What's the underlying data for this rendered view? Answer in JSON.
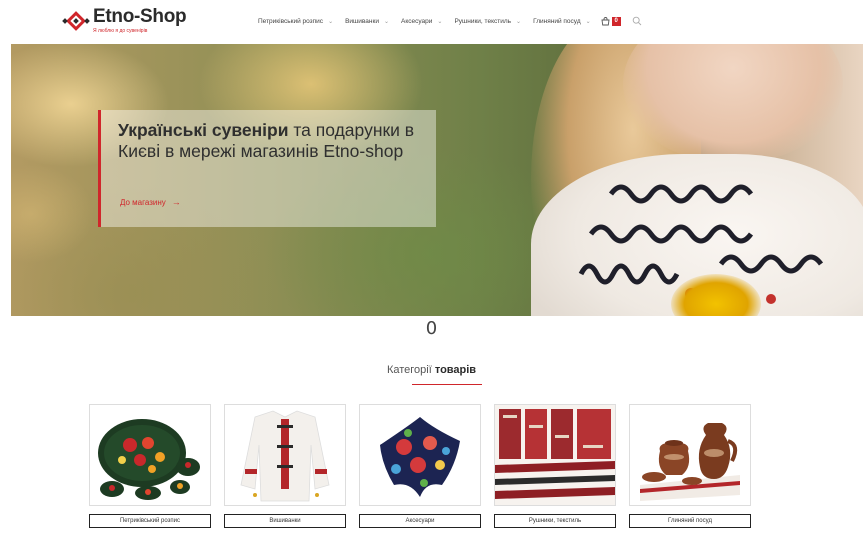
{
  "brand": {
    "name": "Etno-Shop",
    "tagline": "Я люблю я до сувенірів"
  },
  "nav": {
    "items": [
      {
        "label": "Петриківський розпис"
      },
      {
        "label": "Вишиванки"
      },
      {
        "label": "Аксесуари"
      },
      {
        "label": "Рушники, текстиль"
      },
      {
        "label": "Глиняний посуд"
      }
    ],
    "cart_count": "0",
    "icons": [
      "cart-icon",
      "search-icon",
      "chevron-down-icon"
    ]
  },
  "hero": {
    "title_bold": "Українські сувеніри",
    "title_rest": " та подарунки в Києві в мережі магазинів Etno-shop",
    "cta_label": "До магазину",
    "cta_arrow": "→"
  },
  "counter": "0",
  "section": {
    "title_light": "Категорії ",
    "title_bold": "товарів"
  },
  "categories": [
    {
      "label": "Петриківський розпис",
      "image": "petrykivka-dishes"
    },
    {
      "label": "Вишиванки",
      "image": "embroidered-shirt"
    },
    {
      "label": "Аксесуари",
      "image": "floral-scarf"
    },
    {
      "label": "Рушники, текстиль",
      "image": "embroidered-towels"
    },
    {
      "label": "Глиняний посуд",
      "image": "clay-pottery"
    }
  ],
  "colors": {
    "accent": "#d0262b",
    "text": "#2b2b2b"
  }
}
